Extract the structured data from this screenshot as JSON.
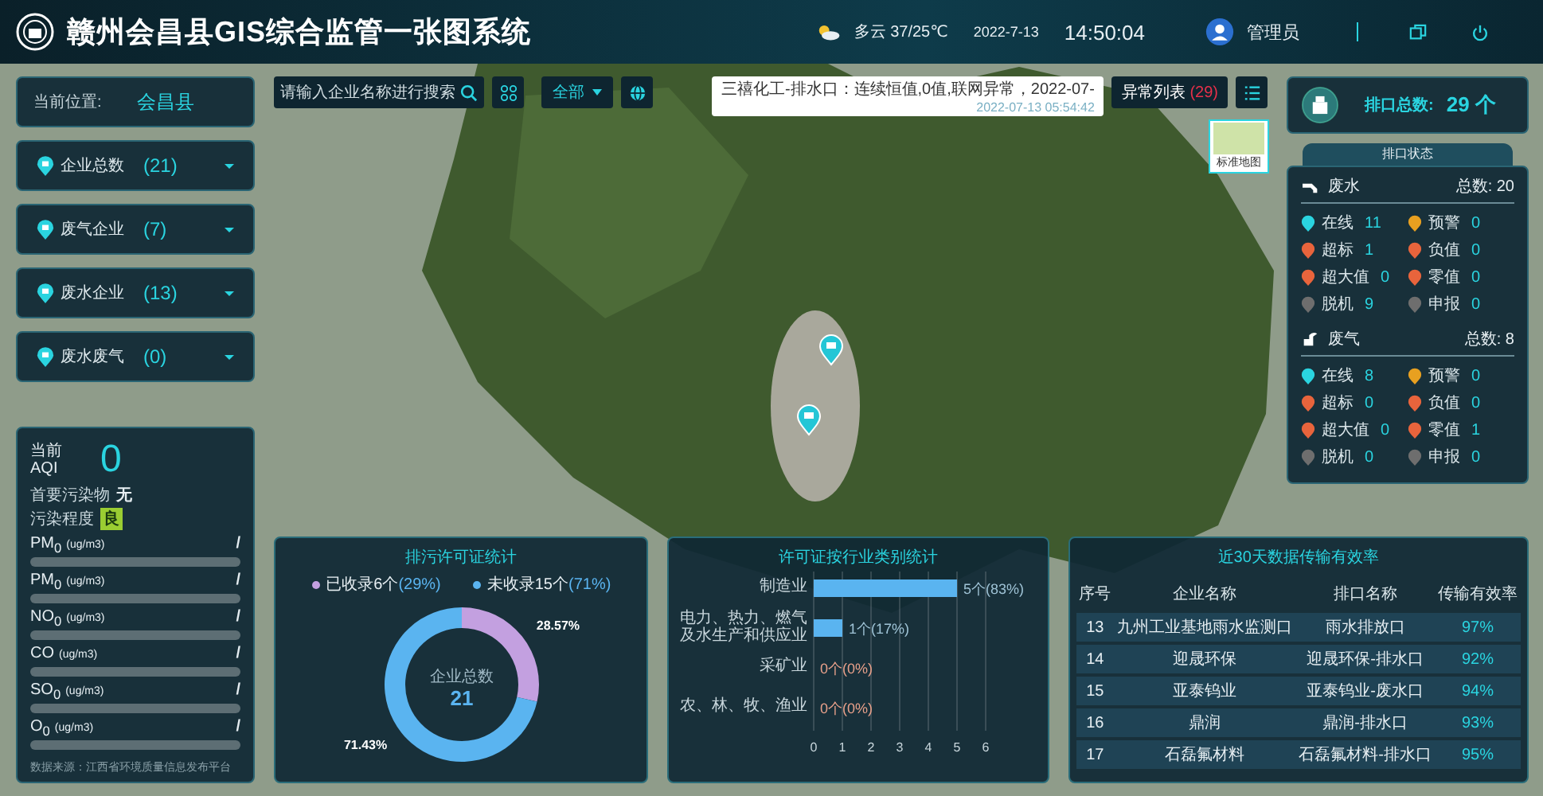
{
  "header": {
    "title": "赣州会昌县GIS综合监管一张图系统",
    "weather": "多云 37/25℃",
    "date": "2022-7-13",
    "time": "14:50:04",
    "user": "管理员"
  },
  "toolbar": {
    "search": {
      "placeholder": "请输入企业名称进行搜索"
    },
    "filter": "全部",
    "alert": {
      "message": "三禧化工-排水口：连续恒值,0值,联网异常，2022-07-",
      "time": "2022-07-13 05:54:42"
    },
    "abnormal": {
      "label": "异常列表",
      "count": "(29)"
    }
  },
  "map": {
    "basemap_label": "标准地图",
    "basemap_selected": true
  },
  "location": {
    "label": "当前位置:",
    "value": "会昌县"
  },
  "categories": [
    {
      "label": "企业总数",
      "count": "(21)"
    },
    {
      "label": "废气企业",
      "count": "(7)"
    },
    {
      "label": "废水企业",
      "count": "(13)"
    },
    {
      "label": "废水废气",
      "count": "(0)"
    }
  ],
  "air": {
    "aqi_label": "当前 AQI",
    "aqi": "0",
    "primary_label": "首要污染物",
    "primary_value": "无",
    "degree_label": "污染程度",
    "degree_value": "良",
    "pollutants": [
      {
        "name": "PM$_{0}$",
        "unit": "(ug/m3)",
        "reading": "/"
      },
      {
        "name": "PM$_{0}$",
        "unit": "(ug/m3)",
        "reading": "/"
      },
      {
        "name": "NO$_{0}$",
        "unit": "(ug/m3)",
        "reading": "/"
      },
      {
        "name": "CO",
        "unit": "(ug/m3)",
        "reading": "/"
      },
      {
        "name": "SO$_{0}$",
        "unit": "(ug/m3)",
        "reading": "/"
      },
      {
        "name": "O$_{0}$",
        "unit": "(ug/m3)",
        "reading": "/"
      }
    ],
    "source": "数据来源：江西省环境质量信息发布平台"
  },
  "outlets": {
    "total_label": "排口总数:",
    "total_value": "29 个",
    "status_title": "排口状态",
    "groups": [
      {
        "kind": "water",
        "name": "废水",
        "total": "总数: 20",
        "items": [
          {
            "label": "在线",
            "count": "11",
            "color": "#2ad4e0"
          },
          {
            "label": "预警",
            "count": "0",
            "color": "#e8a020"
          },
          {
            "label": "超标",
            "count": "1",
            "color": "#e8643c"
          },
          {
            "label": "负值",
            "count": "0",
            "color": "#e8643c"
          },
          {
            "label": "超大值",
            "count": "0",
            "color": "#e8643c"
          },
          {
            "label": "零值",
            "count": "0",
            "color": "#e8643c"
          },
          {
            "label": "脱机",
            "count": "9",
            "color": "#6e6e6e"
          },
          {
            "label": "申报",
            "count": "0",
            "color": "#6e6e6e"
          }
        ]
      },
      {
        "kind": "gas",
        "name": "废气",
        "total": "总数: 8",
        "items": [
          {
            "label": "在线",
            "count": "8",
            "color": "#2ad4e0"
          },
          {
            "label": "预警",
            "count": "0",
            "color": "#e8a020"
          },
          {
            "label": "超标",
            "count": "0",
            "color": "#e8643c"
          },
          {
            "label": "负值",
            "count": "0",
            "color": "#e8643c"
          },
          {
            "label": "超大值",
            "count": "0",
            "color": "#e8643c"
          },
          {
            "label": "零值",
            "count": "1",
            "color": "#e8643c"
          },
          {
            "label": "脱机",
            "count": "0",
            "color": "#6e6e6e"
          },
          {
            "label": "申报",
            "count": "0",
            "color": "#6e6e6e"
          }
        ]
      }
    ]
  },
  "permits": {
    "title": "排污许可证统计",
    "legend": [
      {
        "share": "(29%)",
        "color": "#c3a0e0"
      },
      {
        "share": "(71%)",
        "color": "#5ab4f0"
      }
    ],
    "center_label": "企业总数",
    "center_value": "21",
    "chart_data": {
      "type": "donut",
      "categories": [
        "已收录6个",
        "未收录15个"
      ],
      "series": [
        {
          "values": [
            6,
            15
          ]
        }
      ],
      "value_labels": [
        "28.57%",
        "71.43%"
      ]
    }
  },
  "industry": {
    "title": "许可证按行业类别统计",
    "chart_data": {
      "type": "bar",
      "orientation": "horizontal",
      "categories": [
        "制造业",
        "电力、热力、燃气及水生产和供应业",
        "采矿业",
        "农、林、牧、渔业"
      ],
      "series": [
        {
          "color": "#5ab4f0",
          "values": [
            5,
            1,
            0,
            0
          ]
        }
      ],
      "grid": true,
      "xlim": [
        0,
        6
      ],
      "xticks": [
        {
          "value": 0,
          "label": "0"
        },
        {
          "value": 1,
          "label": "1"
        },
        {
          "value": 2,
          "label": "2"
        },
        {
          "value": 3,
          "label": "3"
        },
        {
          "value": 4,
          "label": "4"
        },
        {
          "value": 5,
          "label": "5"
        },
        {
          "value": 6,
          "label": "6"
        }
      ],
      "value_labels": [
        "5个(83%)",
        "1个(17%)",
        "0个(0%)",
        "0个(0%)"
      ]
    }
  },
  "transmission": {
    "title": "近30天数据传输有效率",
    "columns": [
      "序号",
      "企业名称",
      "排口名称",
      "传输有效率"
    ],
    "rows": [
      [
        "13",
        "九州工业基地雨水监测口",
        "雨水排放口",
        "97%"
      ],
      [
        "14",
        "迎晟环保",
        "迎晟环保-排水口",
        "92%"
      ],
      [
        "15",
        "亚泰钨业",
        "亚泰钨业-废水口",
        "94%"
      ],
      [
        "16",
        "鼎润",
        "鼎润-排水口",
        "93%"
      ],
      [
        "17",
        "石磊氟材料",
        "石磊氟材料-排水口",
        "95%"
      ]
    ]
  }
}
